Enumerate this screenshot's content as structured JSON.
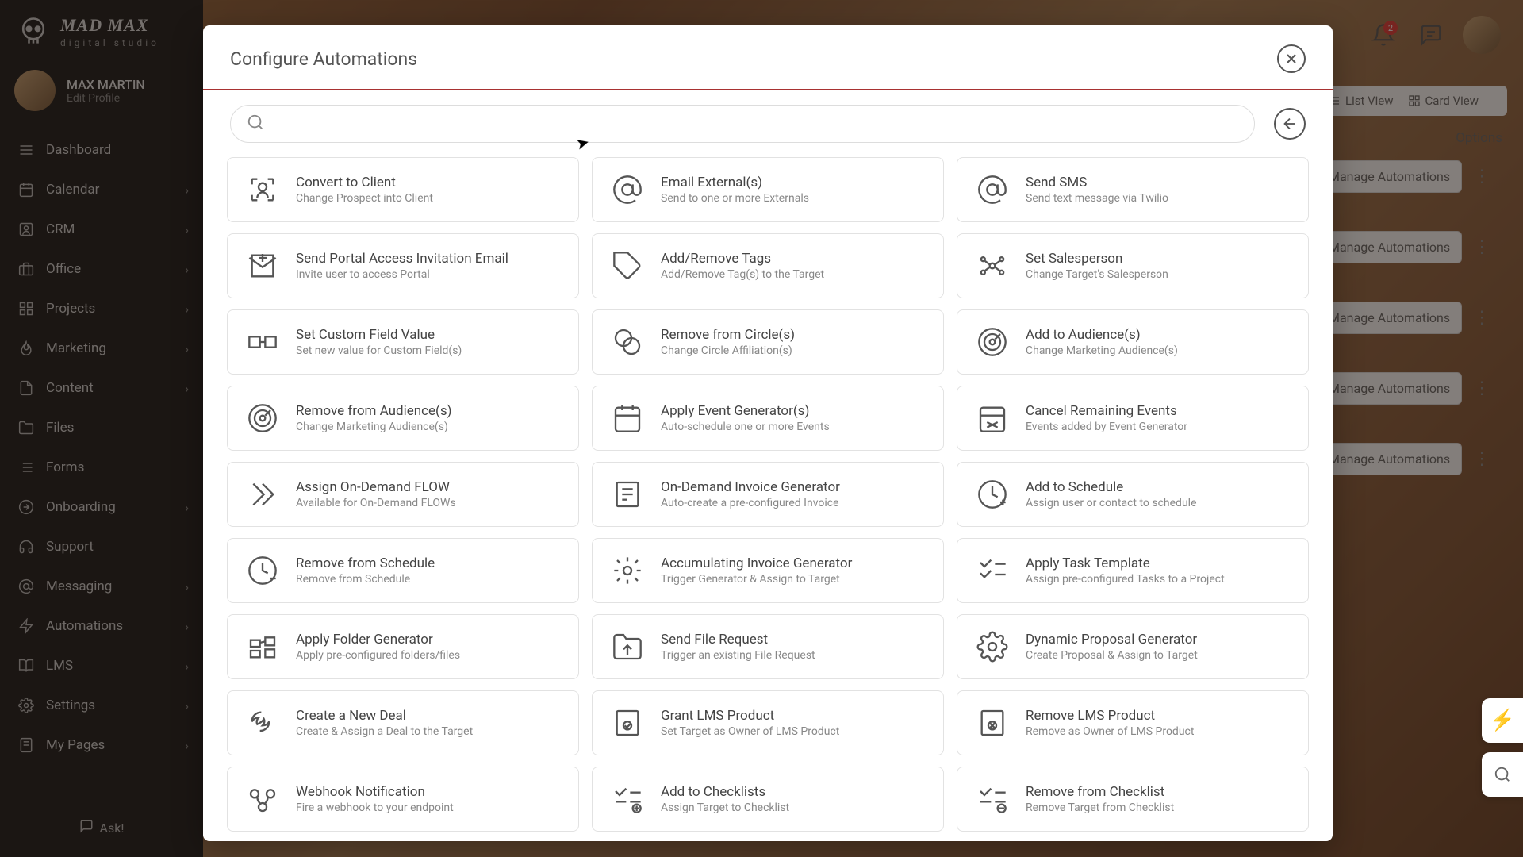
{
  "brand": {
    "title": "MAD MAX",
    "subtitle": "digital studio"
  },
  "user": {
    "name": "MAX MARTIN",
    "edit": "Edit Profile"
  },
  "nav": {
    "items": [
      {
        "label": "Dashboard",
        "icon": "grid",
        "chevron": false
      },
      {
        "label": "Calendar",
        "icon": "calendar",
        "chevron": true
      },
      {
        "label": "CRM",
        "icon": "users",
        "chevron": true
      },
      {
        "label": "Office",
        "icon": "briefcase",
        "chevron": true
      },
      {
        "label": "Projects",
        "icon": "layers",
        "chevron": true
      },
      {
        "label": "Marketing",
        "icon": "flame",
        "chevron": true
      },
      {
        "label": "Content",
        "icon": "file",
        "chevron": true
      },
      {
        "label": "Files",
        "icon": "folder",
        "chevron": false
      },
      {
        "label": "Forms",
        "icon": "list",
        "chevron": false
      },
      {
        "label": "Onboarding",
        "icon": "arrow",
        "chevron": true
      },
      {
        "label": "Support",
        "icon": "headset",
        "chevron": false
      },
      {
        "label": "Messaging",
        "icon": "at",
        "chevron": true
      },
      {
        "label": "Automations",
        "icon": "bolt",
        "chevron": true
      },
      {
        "label": "LMS",
        "icon": "book",
        "chevron": true
      },
      {
        "label": "Settings",
        "icon": "gear",
        "chevron": true
      },
      {
        "label": "My Pages",
        "icon": "page",
        "chevron": true
      }
    ],
    "ask": "Ask!"
  },
  "header": {
    "notif_count": "2"
  },
  "views": {
    "list": "List View",
    "card": "Card View",
    "options": "Options",
    "manage": "Manage Automations"
  },
  "modal": {
    "title": "Configure Automations",
    "search_placeholder": "",
    "cards": [
      {
        "title": "Convert to Client",
        "sub": "Change Prospect into Client"
      },
      {
        "title": "Email External(s)",
        "sub": "Send to one or more Externals"
      },
      {
        "title": "Send SMS",
        "sub": "Send text message via Twilio"
      },
      {
        "title": "Send Portal Access Invitation Email",
        "sub": "Invite user to access Portal"
      },
      {
        "title": "Add/Remove Tags",
        "sub": "Add/Remove Tag(s) to the Target"
      },
      {
        "title": "Set Salesperson",
        "sub": "Change Target's Salesperson"
      },
      {
        "title": "Set Custom Field Value",
        "sub": "Set new value for Custom Field(s)"
      },
      {
        "title": "Remove from Circle(s)",
        "sub": "Change Circle Affiliation(s)"
      },
      {
        "title": "Add to Audience(s)",
        "sub": "Change Marketing Audience(s)"
      },
      {
        "title": "Remove from Audience(s)",
        "sub": "Change Marketing Audience(s)"
      },
      {
        "title": "Apply Event Generator(s)",
        "sub": "Auto-schedule one or more Events"
      },
      {
        "title": "Cancel Remaining Events",
        "sub": "Events added by Event Generator"
      },
      {
        "title": "Assign On-Demand FLOW",
        "sub": "Available for On-Demand FLOWs"
      },
      {
        "title": "On-Demand Invoice Generator",
        "sub": "Auto-create a pre-configured Invoice"
      },
      {
        "title": "Add to Schedule",
        "sub": "Assign user or contact to schedule"
      },
      {
        "title": "Remove from Schedule",
        "sub": "Remove from Schedule"
      },
      {
        "title": "Accumulating Invoice Generator",
        "sub": "Trigger Generator & Assign to Target"
      },
      {
        "title": "Apply Task Template",
        "sub": "Assign pre-configured Tasks to a Project"
      },
      {
        "title": "Apply Folder Generator",
        "sub": "Apply pre-configured folders/files"
      },
      {
        "title": "Send File Request",
        "sub": "Trigger an existing File Request"
      },
      {
        "title": "Dynamic Proposal Generator",
        "sub": "Create Proposal & Assign to Target"
      },
      {
        "title": "Create a New Deal",
        "sub": "Create & Assign a Deal to the Target"
      },
      {
        "title": "Grant LMS Product",
        "sub": "Set Target as Owner of LMS Product"
      },
      {
        "title": "Remove LMS Product",
        "sub": "Remove as Owner of LMS Product"
      },
      {
        "title": "Webhook Notification",
        "sub": "Fire a webhook to your endpoint"
      },
      {
        "title": "Add to Checklists",
        "sub": "Assign Target to Checklist"
      },
      {
        "title": "Remove from Checklist",
        "sub": "Remove Target from Checklist"
      }
    ]
  }
}
